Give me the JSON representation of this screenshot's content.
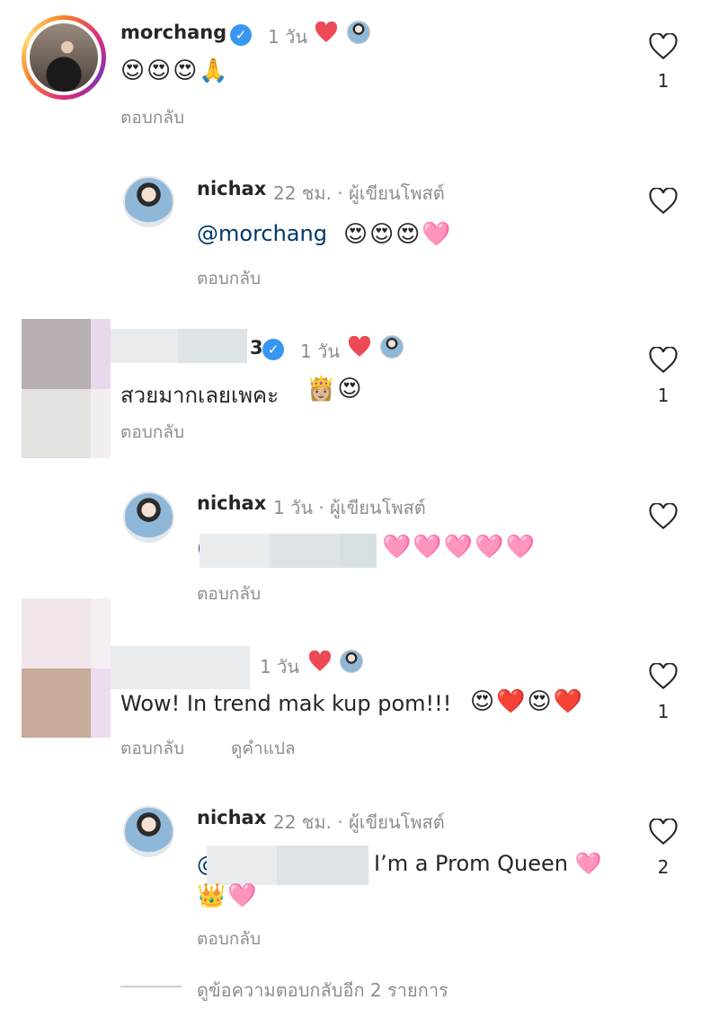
{
  "icons": {
    "like": "heart-outline-icon",
    "author_liked": "red-heart-icon",
    "verified": "verified-badge-icon"
  },
  "colors": {
    "mention": "#00376b",
    "meta": "#8e8e8e",
    "verified": "#3897f0",
    "liked_heart": "#ed4956"
  },
  "comments": [
    {
      "username": "morchang",
      "time": "1 วัน",
      "verified": true,
      "text": "😍😍😍🙏",
      "reply_label": "ตอบกลับ",
      "likes": "1",
      "replies": [
        {
          "username": "nichax",
          "meta": "22 ชม. · ผู้เขียนโพสต์",
          "mention": "@morchang",
          "text": "😍😍😍🩷",
          "reply_label": "ตอบกลับ"
        }
      ]
    },
    {
      "username_tail": "3",
      "time": "1 วัน",
      "verified": true,
      "text": "สวยมากเลยเพคะ",
      "emoji": "👸🏼😍",
      "reply_label": "ตอบกลับ",
      "likes": "1",
      "replies": [
        {
          "username": "nichax",
          "meta": "1 วัน · ผู้เขียนโพสต์",
          "mention_start": "(",
          "text": "🩷🩷🩷🩷🩷",
          "reply_label": "ตอบกลับ"
        }
      ]
    },
    {
      "time": "1 วัน",
      "text": "Wow! In trend mak kup pom!!!",
      "emoji": "😍❤️😍❤️",
      "reply_label": "ตอบกลับ",
      "translate_label": "ดูคำแปล",
      "likes": "1",
      "replies": [
        {
          "username": "nichax",
          "meta": "22 ชม. · ผู้เขียนโพสต์",
          "mention_start": "@",
          "text": "I’m a Prom Queen 🩷",
          "text_line2": "👑🩷",
          "reply_label": "ตอบกลับ",
          "likes": "2"
        }
      ]
    }
  ],
  "view_more_replies": "ดูข้อความตอบกลับอีก 2 รายการ"
}
